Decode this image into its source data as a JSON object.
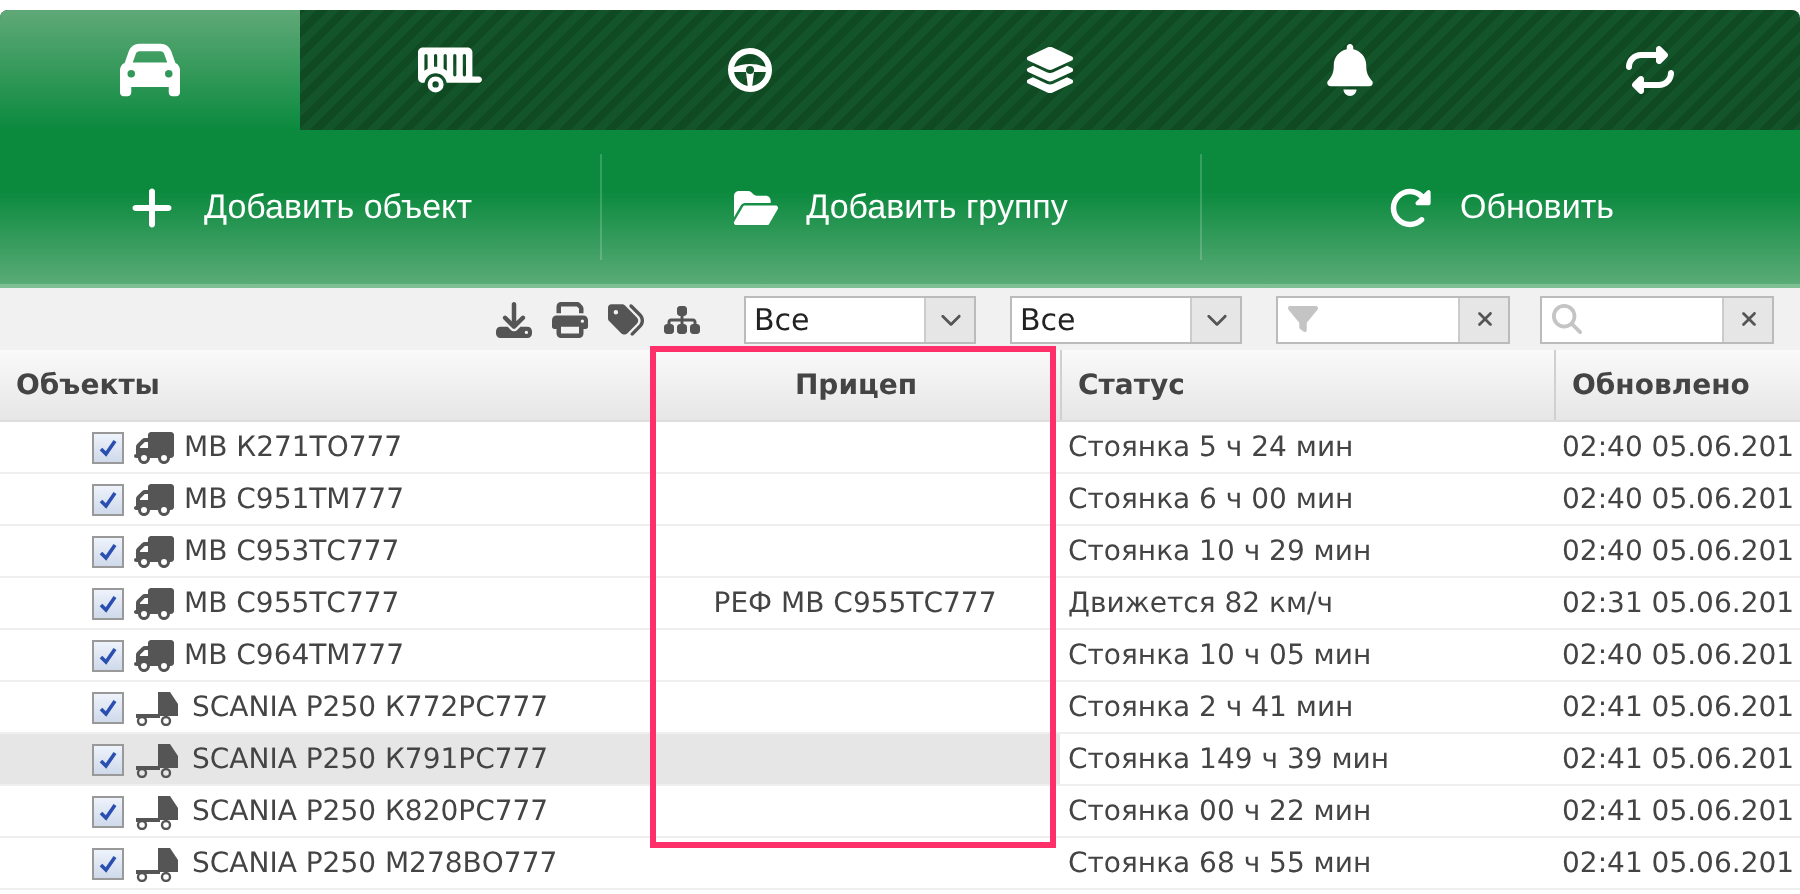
{
  "tabs": [
    {
      "kind": "car",
      "selected": true
    },
    {
      "kind": "trailer",
      "selected": false
    },
    {
      "kind": "wheel",
      "selected": false
    },
    {
      "kind": "layers",
      "selected": false
    },
    {
      "kind": "bell",
      "selected": false
    },
    {
      "kind": "swap",
      "selected": false
    }
  ],
  "actions": [
    {
      "kind": "add",
      "label": "Добавить объект"
    },
    {
      "kind": "folder",
      "label": "Добавить группу"
    },
    {
      "kind": "refresh",
      "label": "Обновить"
    }
  ],
  "toolbar": {
    "selects": [
      {
        "value": "Все"
      },
      {
        "value": "Все"
      }
    ],
    "fields": [
      {
        "kind": "filter"
      },
      {
        "kind": "search"
      }
    ]
  },
  "table": {
    "columns": [
      {
        "label": "Объекты",
        "highlighted": false
      },
      {
        "label": "Прицеп",
        "highlighted": true
      },
      {
        "label": "Статус",
        "highlighted": false
      },
      {
        "label": "Обновлено",
        "highlighted": false
      }
    ],
    "rows": [
      {
        "kind": "box",
        "checked": true,
        "selected": false,
        "name": "МВ К271ТО777",
        "trailer": "",
        "status": "Стоянка 5 ч 24 мин",
        "updated": "02:40 05.06.201"
      },
      {
        "kind": "box",
        "checked": true,
        "selected": false,
        "name": "МВ С951ТМ777",
        "trailer": "",
        "status": "Стоянка 6 ч 00 мин",
        "updated": "02:40 05.06.201"
      },
      {
        "kind": "box",
        "checked": true,
        "selected": false,
        "name": "МВ С953ТС777",
        "trailer": "",
        "status": "Стоянка 10 ч 29 мин",
        "updated": "02:40 05.06.201"
      },
      {
        "kind": "box",
        "checked": true,
        "selected": false,
        "name": "МВ С955ТС777",
        "trailer": "РЕФ МВ С955ТС777",
        "status": "Движется 82 км/ч",
        "updated": "02:31 05.06.201"
      },
      {
        "kind": "box",
        "checked": true,
        "selected": false,
        "name": "МВ С964ТМ777",
        "trailer": "",
        "status": "Стоянка 10 ч 05 мин",
        "updated": "02:40 05.06.201"
      },
      {
        "kind": "tractor",
        "checked": true,
        "selected": false,
        "name": "SCANIA P250 К772РС777",
        "trailer": "",
        "status": "Стоянка 2 ч 41 мин",
        "updated": "02:41 05.06.201"
      },
      {
        "kind": "tractor",
        "checked": true,
        "selected": true,
        "name": "SCANIA P250 К791РС777",
        "trailer": "",
        "status": "Стоянка 149 ч 39 мин",
        "updated": "02:41 05.06.201"
      },
      {
        "kind": "tractor",
        "checked": true,
        "selected": false,
        "name": "SCANIA P250 К820РС777",
        "trailer": "",
        "status": "Стоянка 00 ч 22 мин",
        "updated": "02:41 05.06.201"
      },
      {
        "kind": "tractor",
        "checked": true,
        "selected": false,
        "name": "SCANIA P250 М278ВО777",
        "trailer": "",
        "status": "Стоянка 68 ч 55 мин",
        "updated": "02:41 05.06.201"
      }
    ]
  }
}
